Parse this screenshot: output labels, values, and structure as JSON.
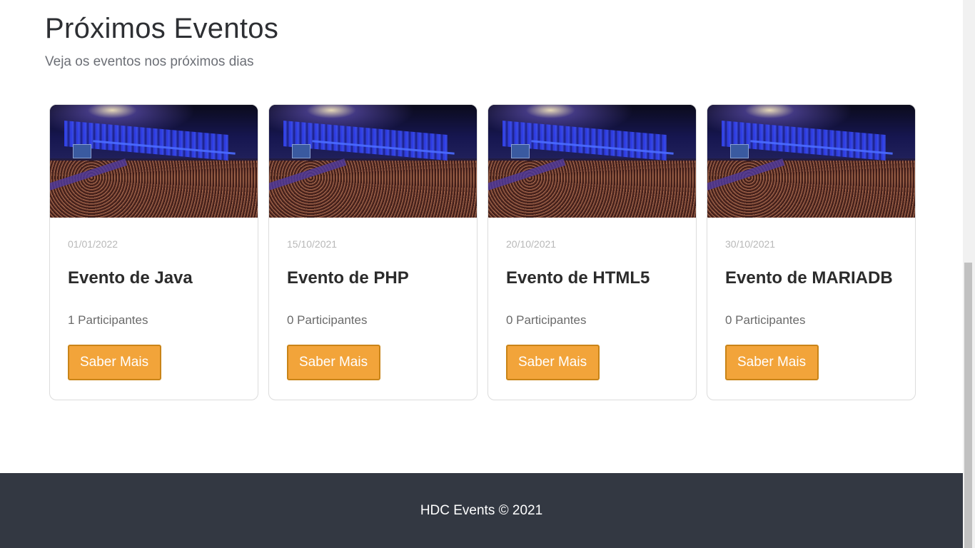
{
  "header": {
    "title": "Próximos Eventos",
    "subtitle": "Veja os eventos nos próximos dias"
  },
  "events": [
    {
      "date": "01/01/2022",
      "title": "Evento de Java",
      "participants": "1 Participantes",
      "button_label": "Saber Mais"
    },
    {
      "date": "15/10/2021",
      "title": "Evento de PHP",
      "participants": "0 Participantes",
      "button_label": "Saber Mais"
    },
    {
      "date": "20/10/2021",
      "title": "Evento de HTML5",
      "participants": "0 Participantes",
      "button_label": "Saber Mais"
    },
    {
      "date": "30/10/2021",
      "title": "Evento de MARIADB",
      "participants": "0 Participantes",
      "button_label": "Saber Mais"
    }
  ],
  "footer": {
    "text": "HDC Events © 2021"
  },
  "colors": {
    "button": "#f2a43a",
    "button_border": "#c98418",
    "footer_bg": "#333842"
  }
}
